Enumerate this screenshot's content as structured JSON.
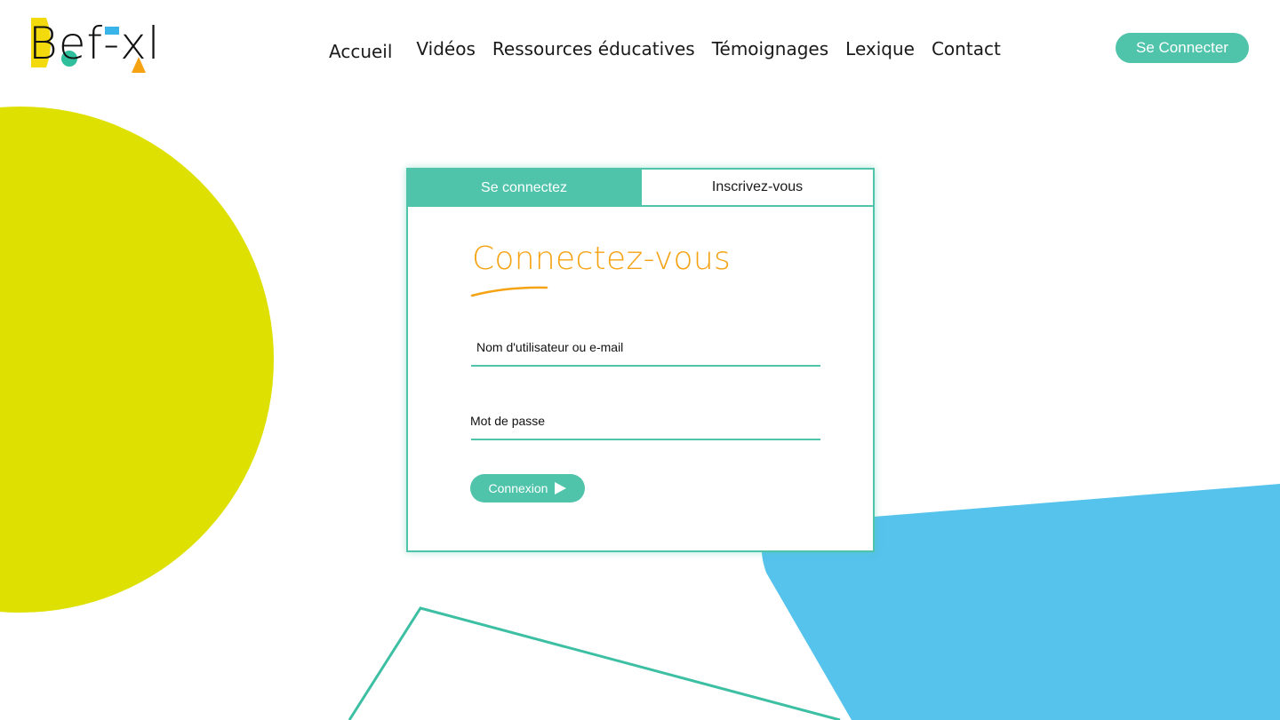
{
  "colors": {
    "accent": "#4fc4aa",
    "title_orange": "#f5a313",
    "yellow_circle": "#dde000",
    "blue_shape": "#55c3ec",
    "logo_yellow": "#f2da0c",
    "logo_blue": "#38b4e8",
    "logo_green": "#2fbf9d",
    "logo_orange": "#f5a313"
  },
  "header": {
    "logo_text": "Bef-xl",
    "nav": [
      "Accueil",
      "Vidéos",
      "Ressources éducatives",
      "Témoignages",
      "Lexique",
      "Contact"
    ],
    "connect_button": "Se Connecter"
  },
  "login": {
    "tabs": {
      "login": "Se connectez",
      "register": "Inscrivez-vous"
    },
    "title": "Connectez-vous",
    "username_label": "Nom d'utilisateur ou e-mail",
    "password_label": "Mot de passe",
    "submit_label": "Connexion"
  }
}
